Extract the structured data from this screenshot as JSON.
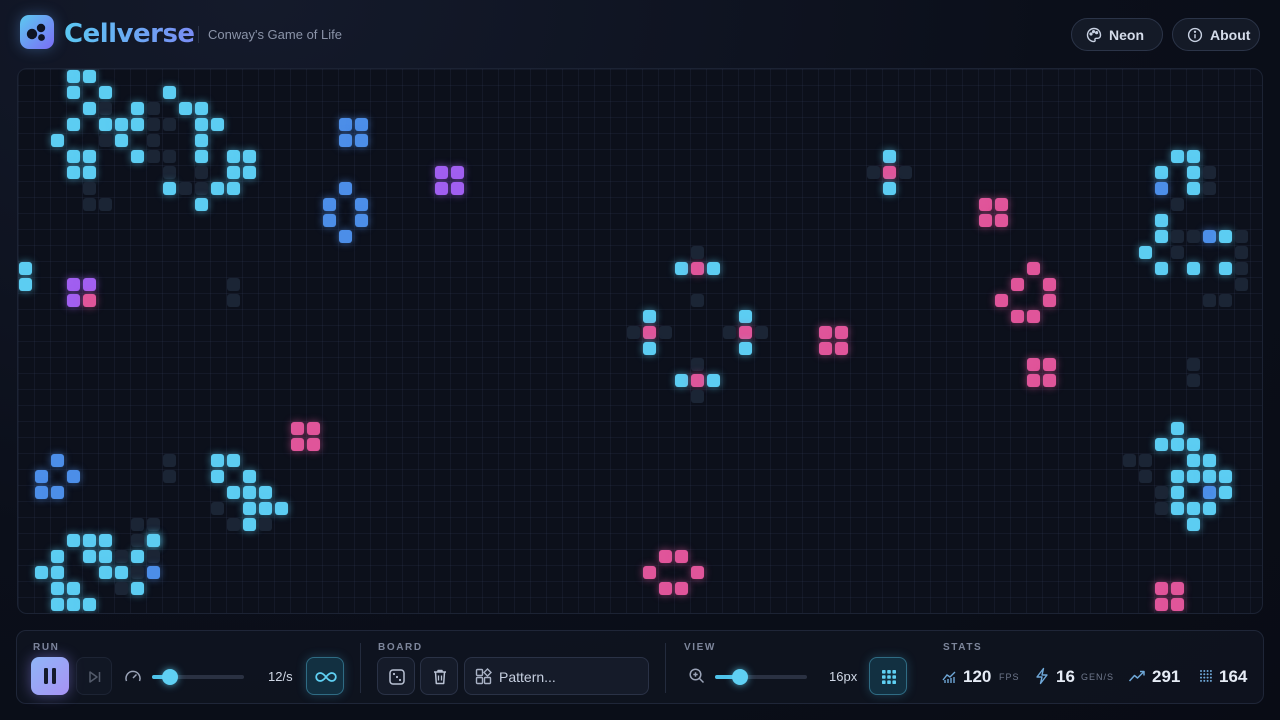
{
  "app": {
    "name": "Cellverse",
    "subtitle": "Conway's Game of Life"
  },
  "header": {
    "theme_label": "Neon",
    "about_label": "About"
  },
  "board": {
    "cell_size_px": 16,
    "palette": {
      "cyan": "#5ccdf2",
      "blue": "#4c8ee8",
      "pink": "#e0559a",
      "purple": "#a15ff0",
      "ghost": "#1b2535",
      "grid": "#1a2131",
      "background": "#0c101b"
    },
    "cells": [
      {
        "c": 3,
        "r": 0,
        "t": "c"
      },
      {
        "c": 4,
        "r": 0,
        "t": "c"
      },
      {
        "c": 3,
        "r": 1,
        "t": "c"
      },
      {
        "c": 5,
        "r": 1,
        "t": "c"
      },
      {
        "c": 9,
        "r": 1,
        "t": "c"
      },
      {
        "c": 4,
        "r": 2,
        "t": "c"
      },
      {
        "c": 7,
        "r": 2,
        "t": "c"
      },
      {
        "c": 10,
        "r": 2,
        "t": "c"
      },
      {
        "c": 11,
        "r": 2,
        "t": "c"
      },
      {
        "c": 8,
        "r": 2,
        "t": "g"
      },
      {
        "c": 5,
        "r": 2,
        "t": "g"
      },
      {
        "c": 3,
        "r": 3,
        "t": "c"
      },
      {
        "c": 5,
        "r": 3,
        "t": "c"
      },
      {
        "c": 6,
        "r": 3,
        "t": "c"
      },
      {
        "c": 7,
        "r": 3,
        "t": "c"
      },
      {
        "c": 11,
        "r": 3,
        "t": "c"
      },
      {
        "c": 12,
        "r": 3,
        "t": "c"
      },
      {
        "c": 20,
        "r": 3,
        "t": "b"
      },
      {
        "c": 21,
        "r": 3,
        "t": "b"
      },
      {
        "c": 8,
        "r": 3,
        "t": "g"
      },
      {
        "c": 9,
        "r": 3,
        "t": "g"
      },
      {
        "c": 2,
        "r": 4,
        "t": "c"
      },
      {
        "c": 6,
        "r": 4,
        "t": "c"
      },
      {
        "c": 11,
        "r": 4,
        "t": "c"
      },
      {
        "c": 20,
        "r": 4,
        "t": "b"
      },
      {
        "c": 21,
        "r": 4,
        "t": "b"
      },
      {
        "c": 5,
        "r": 4,
        "t": "g"
      },
      {
        "c": 8,
        "r": 4,
        "t": "g"
      },
      {
        "c": 3,
        "r": 5,
        "t": "c"
      },
      {
        "c": 4,
        "r": 5,
        "t": "c"
      },
      {
        "c": 7,
        "r": 5,
        "t": "c"
      },
      {
        "c": 11,
        "r": 5,
        "t": "c"
      },
      {
        "c": 13,
        "r": 5,
        "t": "c"
      },
      {
        "c": 14,
        "r": 5,
        "t": "c"
      },
      {
        "c": 54,
        "r": 5,
        "t": "c"
      },
      {
        "c": 72,
        "r": 5,
        "t": "c"
      },
      {
        "c": 73,
        "r": 5,
        "t": "c"
      },
      {
        "c": 8,
        "r": 5,
        "t": "g"
      },
      {
        "c": 9,
        "r": 5,
        "t": "g"
      },
      {
        "c": 3,
        "r": 6,
        "t": "c"
      },
      {
        "c": 4,
        "r": 6,
        "t": "c"
      },
      {
        "c": 13,
        "r": 6,
        "t": "c"
      },
      {
        "c": 14,
        "r": 6,
        "t": "c"
      },
      {
        "c": 26,
        "r": 6,
        "t": "p"
      },
      {
        "c": 27,
        "r": 6,
        "t": "p"
      },
      {
        "c": 54,
        "r": 6,
        "t": "k"
      },
      {
        "c": 71,
        "r": 6,
        "t": "c"
      },
      {
        "c": 73,
        "r": 6,
        "t": "c"
      },
      {
        "c": 9,
        "r": 6,
        "t": "g"
      },
      {
        "c": 11,
        "r": 6,
        "t": "g"
      },
      {
        "c": 53,
        "r": 6,
        "t": "g"
      },
      {
        "c": 55,
        "r": 6,
        "t": "g"
      },
      {
        "c": 74,
        "r": 6,
        "t": "g"
      },
      {
        "c": 9,
        "r": 7,
        "t": "c"
      },
      {
        "c": 12,
        "r": 7,
        "t": "c"
      },
      {
        "c": 13,
        "r": 7,
        "t": "c"
      },
      {
        "c": 20,
        "r": 7,
        "t": "b"
      },
      {
        "c": 26,
        "r": 7,
        "t": "p"
      },
      {
        "c": 27,
        "r": 7,
        "t": "p"
      },
      {
        "c": 54,
        "r": 7,
        "t": "c"
      },
      {
        "c": 71,
        "r": 7,
        "t": "b"
      },
      {
        "c": 73,
        "r": 7,
        "t": "c"
      },
      {
        "c": 4,
        "r": 7,
        "t": "g"
      },
      {
        "c": 10,
        "r": 7,
        "t": "g"
      },
      {
        "c": 11,
        "r": 7,
        "t": "g"
      },
      {
        "c": 74,
        "r": 7,
        "t": "g"
      },
      {
        "c": 11,
        "r": 8,
        "t": "c"
      },
      {
        "c": 60,
        "r": 8,
        "t": "k"
      },
      {
        "c": 61,
        "r": 8,
        "t": "k"
      },
      {
        "c": 19,
        "r": 8,
        "t": "b"
      },
      {
        "c": 21,
        "r": 8,
        "t": "b"
      },
      {
        "c": 4,
        "r": 8,
        "t": "g"
      },
      {
        "c": 5,
        "r": 8,
        "t": "g"
      },
      {
        "c": 72,
        "r": 8,
        "t": "g"
      },
      {
        "c": 19,
        "r": 9,
        "t": "b"
      },
      {
        "c": 21,
        "r": 9,
        "t": "b"
      },
      {
        "c": 60,
        "r": 9,
        "t": "k"
      },
      {
        "c": 61,
        "r": 9,
        "t": "k"
      },
      {
        "c": 71,
        "r": 9,
        "t": "c"
      },
      {
        "c": 20,
        "r": 10,
        "t": "b"
      },
      {
        "c": 71,
        "r": 10,
        "t": "c"
      },
      {
        "c": 74,
        "r": 10,
        "t": "b"
      },
      {
        "c": 75,
        "r": 10,
        "t": "c"
      },
      {
        "c": 72,
        "r": 10,
        "t": "g"
      },
      {
        "c": 73,
        "r": 10,
        "t": "g"
      },
      {
        "c": 76,
        "r": 10,
        "t": "g"
      },
      {
        "c": 70,
        "r": 11,
        "t": "c"
      },
      {
        "c": 72,
        "r": 11,
        "t": "g"
      },
      {
        "c": 76,
        "r": 11,
        "t": "g"
      },
      {
        "c": 0,
        "r": 12,
        "t": "c"
      },
      {
        "c": 41,
        "r": 12,
        "t": "c"
      },
      {
        "c": 42,
        "r": 12,
        "t": "k"
      },
      {
        "c": 43,
        "r": 12,
        "t": "c"
      },
      {
        "c": 63,
        "r": 12,
        "t": "k"
      },
      {
        "c": 71,
        "r": 12,
        "t": "c"
      },
      {
        "c": 73,
        "r": 12,
        "t": "c"
      },
      {
        "c": 75,
        "r": 12,
        "t": "c"
      },
      {
        "c": 42,
        "r": 11,
        "t": "g"
      },
      {
        "c": 76,
        "r": 12,
        "t": "g"
      },
      {
        "c": 0,
        "r": 13,
        "t": "c"
      },
      {
        "c": 3,
        "r": 13,
        "t": "p"
      },
      {
        "c": 4,
        "r": 13,
        "t": "p"
      },
      {
        "c": 62,
        "r": 13,
        "t": "k"
      },
      {
        "c": 64,
        "r": 13,
        "t": "k"
      },
      {
        "c": 13,
        "r": 13,
        "t": "g"
      },
      {
        "c": 76,
        "r": 13,
        "t": "g"
      },
      {
        "c": 3,
        "r": 14,
        "t": "p"
      },
      {
        "c": 4,
        "r": 14,
        "t": "k"
      },
      {
        "c": 61,
        "r": 14,
        "t": "k"
      },
      {
        "c": 64,
        "r": 14,
        "t": "k"
      },
      {
        "c": 13,
        "r": 14,
        "t": "g"
      },
      {
        "c": 42,
        "r": 14,
        "t": "g"
      },
      {
        "c": 74,
        "r": 14,
        "t": "g"
      },
      {
        "c": 75,
        "r": 14,
        "t": "g"
      },
      {
        "c": 39,
        "r": 15,
        "t": "c"
      },
      {
        "c": 45,
        "r": 15,
        "t": "c"
      },
      {
        "c": 62,
        "r": 15,
        "t": "k"
      },
      {
        "c": 63,
        "r": 15,
        "t": "k"
      },
      {
        "c": 39,
        "r": 16,
        "t": "k"
      },
      {
        "c": 45,
        "r": 16,
        "t": "k"
      },
      {
        "c": 50,
        "r": 16,
        "t": "k"
      },
      {
        "c": 51,
        "r": 16,
        "t": "k"
      },
      {
        "c": 38,
        "r": 16,
        "t": "g"
      },
      {
        "c": 40,
        "r": 16,
        "t": "g"
      },
      {
        "c": 44,
        "r": 16,
        "t": "g"
      },
      {
        "c": 46,
        "r": 16,
        "t": "g"
      },
      {
        "c": 39,
        "r": 17,
        "t": "c"
      },
      {
        "c": 45,
        "r": 17,
        "t": "c"
      },
      {
        "c": 50,
        "r": 17,
        "t": "k"
      },
      {
        "c": 51,
        "r": 17,
        "t": "k"
      },
      {
        "c": 63,
        "r": 18,
        "t": "k"
      },
      {
        "c": 64,
        "r": 18,
        "t": "k"
      },
      {
        "c": 42,
        "r": 18,
        "t": "g"
      },
      {
        "c": 73,
        "r": 18,
        "t": "g"
      },
      {
        "c": 41,
        "r": 19,
        "t": "c"
      },
      {
        "c": 42,
        "r": 19,
        "t": "k"
      },
      {
        "c": 43,
        "r": 19,
        "t": "c"
      },
      {
        "c": 63,
        "r": 19,
        "t": "k"
      },
      {
        "c": 64,
        "r": 19,
        "t": "k"
      },
      {
        "c": 73,
        "r": 19,
        "t": "g"
      },
      {
        "c": 42,
        "r": 20,
        "t": "g"
      },
      {
        "c": 17,
        "r": 22,
        "t": "k"
      },
      {
        "c": 18,
        "r": 22,
        "t": "k"
      },
      {
        "c": 72,
        "r": 22,
        "t": "c"
      },
      {
        "c": 17,
        "r": 23,
        "t": "k"
      },
      {
        "c": 18,
        "r": 23,
        "t": "k"
      },
      {
        "c": 71,
        "r": 23,
        "t": "c"
      },
      {
        "c": 72,
        "r": 23,
        "t": "c"
      },
      {
        "c": 73,
        "r": 23,
        "t": "c"
      },
      {
        "c": 2,
        "r": 24,
        "t": "b"
      },
      {
        "c": 12,
        "r": 24,
        "t": "c"
      },
      {
        "c": 13,
        "r": 24,
        "t": "c"
      },
      {
        "c": 73,
        "r": 24,
        "t": "c"
      },
      {
        "c": 74,
        "r": 24,
        "t": "c"
      },
      {
        "c": 9,
        "r": 24,
        "t": "g"
      },
      {
        "c": 69,
        "r": 24,
        "t": "g"
      },
      {
        "c": 70,
        "r": 24,
        "t": "g"
      },
      {
        "c": 1,
        "r": 25,
        "t": "b"
      },
      {
        "c": 3,
        "r": 25,
        "t": "b"
      },
      {
        "c": 12,
        "r": 25,
        "t": "c"
      },
      {
        "c": 14,
        "r": 25,
        "t": "c"
      },
      {
        "c": 72,
        "r": 25,
        "t": "c"
      },
      {
        "c": 73,
        "r": 25,
        "t": "c"
      },
      {
        "c": 74,
        "r": 25,
        "t": "c"
      },
      {
        "c": 75,
        "r": 25,
        "t": "c"
      },
      {
        "c": 9,
        "r": 25,
        "t": "g"
      },
      {
        "c": 70,
        "r": 25,
        "t": "g"
      },
      {
        "c": 1,
        "r": 26,
        "t": "b"
      },
      {
        "c": 2,
        "r": 26,
        "t": "b"
      },
      {
        "c": 13,
        "r": 26,
        "t": "c"
      },
      {
        "c": 14,
        "r": 26,
        "t": "c"
      },
      {
        "c": 15,
        "r": 26,
        "t": "c"
      },
      {
        "c": 72,
        "r": 26,
        "t": "c"
      },
      {
        "c": 74,
        "r": 26,
        "t": "b"
      },
      {
        "c": 75,
        "r": 26,
        "t": "c"
      },
      {
        "c": 71,
        "r": 26,
        "t": "g"
      },
      {
        "c": 14,
        "r": 27,
        "t": "c"
      },
      {
        "c": 15,
        "r": 27,
        "t": "c"
      },
      {
        "c": 16,
        "r": 27,
        "t": "c"
      },
      {
        "c": 72,
        "r": 27,
        "t": "c"
      },
      {
        "c": 73,
        "r": 27,
        "t": "c"
      },
      {
        "c": 74,
        "r": 27,
        "t": "c"
      },
      {
        "c": 12,
        "r": 27,
        "t": "g"
      },
      {
        "c": 71,
        "r": 27,
        "t": "g"
      },
      {
        "c": 14,
        "r": 28,
        "t": "c"
      },
      {
        "c": 73,
        "r": 28,
        "t": "c"
      },
      {
        "c": 7,
        "r": 28,
        "t": "g"
      },
      {
        "c": 8,
        "r": 28,
        "t": "g"
      },
      {
        "c": 13,
        "r": 28,
        "t": "g"
      },
      {
        "c": 15,
        "r": 28,
        "t": "g"
      },
      {
        "c": 3,
        "r": 29,
        "t": "c"
      },
      {
        "c": 4,
        "r": 29,
        "t": "c"
      },
      {
        "c": 5,
        "r": 29,
        "t": "c"
      },
      {
        "c": 8,
        "r": 29,
        "t": "c"
      },
      {
        "c": 8,
        "r": 29,
        "t": "c"
      },
      {
        "c": 7,
        "r": 29,
        "t": "g"
      },
      {
        "c": 2,
        "r": 30,
        "t": "c"
      },
      {
        "c": 4,
        "r": 30,
        "t": "c"
      },
      {
        "c": 5,
        "r": 30,
        "t": "c"
      },
      {
        "c": 7,
        "r": 30,
        "t": "c"
      },
      {
        "c": 40,
        "r": 30,
        "t": "k"
      },
      {
        "c": 41,
        "r": 30,
        "t": "k"
      },
      {
        "c": 6,
        "r": 30,
        "t": "g"
      },
      {
        "c": 8,
        "r": 30,
        "t": "g"
      },
      {
        "c": 1,
        "r": 31,
        "t": "c"
      },
      {
        "c": 2,
        "r": 31,
        "t": "c"
      },
      {
        "c": 5,
        "r": 31,
        "t": "c"
      },
      {
        "c": 6,
        "r": 31,
        "t": "c"
      },
      {
        "c": 8,
        "r": 31,
        "t": "b"
      },
      {
        "c": 39,
        "r": 31,
        "t": "k"
      },
      {
        "c": 42,
        "r": 31,
        "t": "k"
      },
      {
        "c": 7,
        "r": 31,
        "t": "g"
      },
      {
        "c": 2,
        "r": 32,
        "t": "c"
      },
      {
        "c": 3,
        "r": 32,
        "t": "c"
      },
      {
        "c": 7,
        "r": 32,
        "t": "c"
      },
      {
        "c": 40,
        "r": 32,
        "t": "k"
      },
      {
        "c": 41,
        "r": 32,
        "t": "k"
      },
      {
        "c": 71,
        "r": 32,
        "t": "k"
      },
      {
        "c": 72,
        "r": 32,
        "t": "k"
      },
      {
        "c": 6,
        "r": 32,
        "t": "g"
      },
      {
        "c": 2,
        "r": 33,
        "t": "c"
      },
      {
        "c": 3,
        "r": 33,
        "t": "c"
      },
      {
        "c": 4,
        "r": 33,
        "t": "c"
      },
      {
        "c": 71,
        "r": 33,
        "t": "k"
      },
      {
        "c": 72,
        "r": 33,
        "t": "k"
      }
    ]
  },
  "toolbar": {
    "run": {
      "label": "RUN",
      "play_state": "paused-icon-shown",
      "speed_value": 12,
      "speed_max": 60,
      "speed_text": "12/s"
    },
    "board": {
      "label": "BOARD",
      "pattern_placeholder": "Pattern..."
    },
    "view": {
      "label": "VIEW",
      "zoom_fraction": 0.27,
      "zoom_text": "16px"
    },
    "stats": {
      "label": "STATS",
      "fps": "120",
      "fps_unit": "FPS",
      "gen_rate": "16",
      "gen_unit": "GEN/S",
      "generation": "291",
      "population": "164"
    }
  }
}
